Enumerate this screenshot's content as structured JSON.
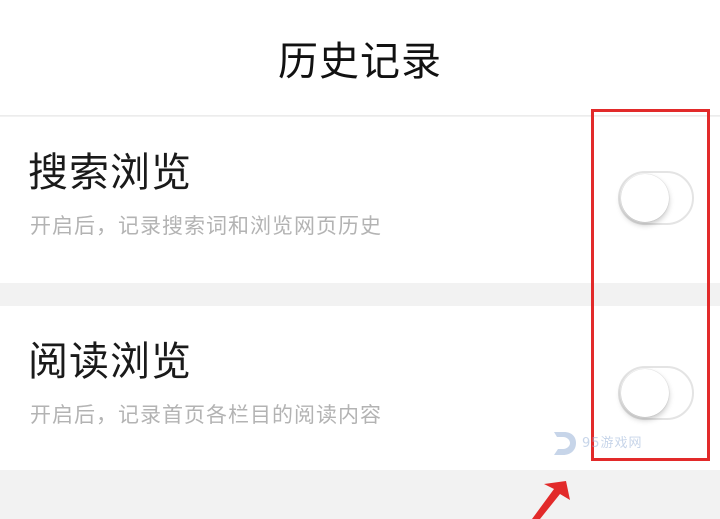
{
  "header": {
    "title": "历史记录"
  },
  "settings": [
    {
      "title": "搜索浏览",
      "description": "开启后，记录搜索词和浏览网页历史",
      "enabled": false
    },
    {
      "title": "阅读浏览",
      "description": "开启后，记录首页各栏目的阅读内容",
      "enabled": false
    }
  ],
  "annotation": {
    "highlight_color": "#e22a2a"
  },
  "watermark": {
    "text": "95游戏网"
  },
  "colors": {
    "background": "#f2f2f2",
    "card": "#ffffff",
    "title_text": "#1a1a1a",
    "description_text": "#b3b3b3"
  }
}
